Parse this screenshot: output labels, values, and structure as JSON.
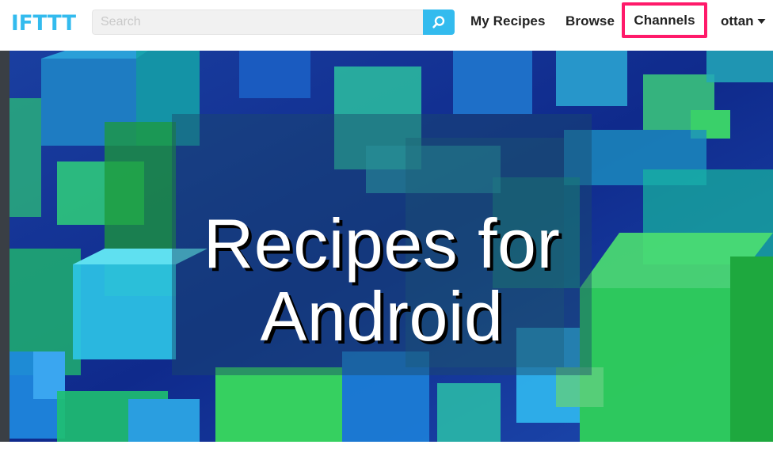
{
  "header": {
    "logo_text": "IFTTT",
    "search": {
      "placeholder": "Search",
      "value": ""
    },
    "nav": {
      "my_recipes": "My Recipes",
      "browse": "Browse",
      "channels": "Channels",
      "user": "ottan"
    }
  },
  "hero": {
    "title_line1": "Recipes for",
    "title_line2": "Android"
  },
  "colors": {
    "brand": "#33bbee",
    "highlight": "#ff1a6a",
    "hero_bg": "#12288a"
  },
  "icons": {
    "search_button": "search-icon",
    "user_menu": "caret-down-icon"
  }
}
